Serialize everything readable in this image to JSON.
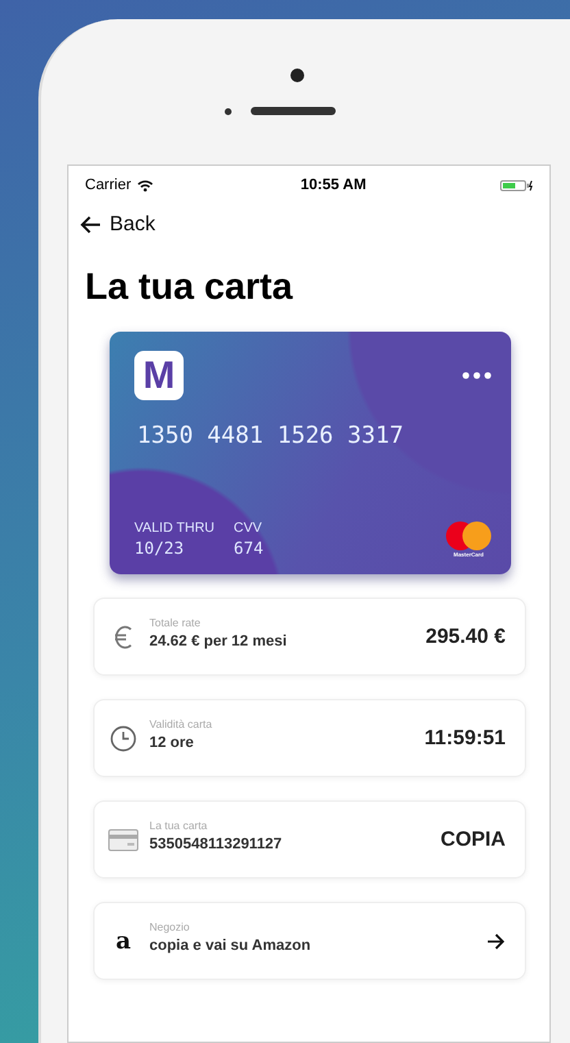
{
  "status_bar": {
    "carrier": "Carrier",
    "time": "10:55 AM"
  },
  "nav": {
    "back": "Back"
  },
  "title": "La tua carta",
  "card": {
    "logo": "M",
    "number": "1350 4481 1526 3317",
    "valid_label": "VALID THRU",
    "valid_value": "10/23",
    "cvv_label": "CVV",
    "cvv_value": "674",
    "brand": "MasterCard"
  },
  "rows": [
    {
      "kind": "euro",
      "label": "Totale rate",
      "value": "24.62 € per 12 mesi",
      "action": "295.40 €"
    },
    {
      "kind": "clock",
      "label": "Validità carta",
      "value": "12 ore",
      "action": "11:59:51"
    },
    {
      "kind": "card",
      "label": "La tua carta",
      "value": "5350548113291127",
      "action": "COPIA"
    },
    {
      "kind": "shop",
      "logo": "a",
      "label": "Negozio",
      "value": "copia e vai su Amazon"
    }
  ]
}
